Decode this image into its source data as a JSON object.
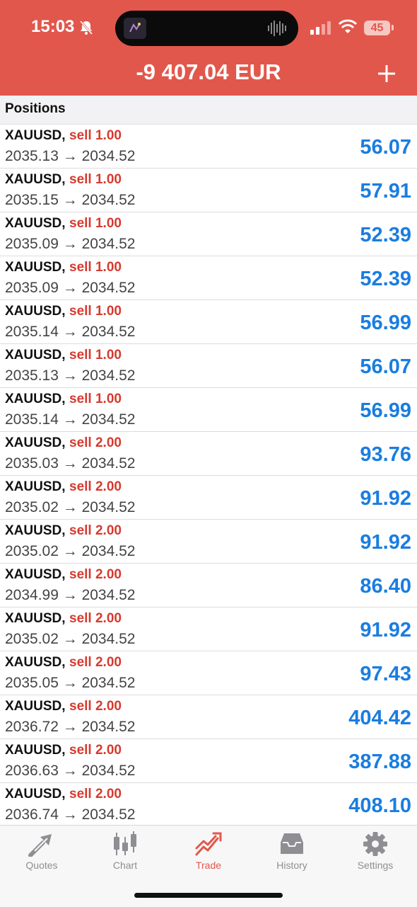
{
  "status_bar": {
    "time": "15:03",
    "battery": "45"
  },
  "header": {
    "balance": "-9 407.04 EUR"
  },
  "section": {
    "title": "Positions"
  },
  "positions": [
    {
      "symbol": "XAUUSD,",
      "side": "sell 1.00",
      "prices": "2035.13 → 2034.52",
      "profit": "56.07"
    },
    {
      "symbol": "XAUUSD,",
      "side": "sell 1.00",
      "prices": "2035.15 → 2034.52",
      "profit": "57.91"
    },
    {
      "symbol": "XAUUSD,",
      "side": "sell 1.00",
      "prices": "2035.09 → 2034.52",
      "profit": "52.39"
    },
    {
      "symbol": "XAUUSD,",
      "side": "sell 1.00",
      "prices": "2035.09 → 2034.52",
      "profit": "52.39"
    },
    {
      "symbol": "XAUUSD,",
      "side": "sell 1.00",
      "prices": "2035.14 → 2034.52",
      "profit": "56.99"
    },
    {
      "symbol": "XAUUSD,",
      "side": "sell 1.00",
      "prices": "2035.13 → 2034.52",
      "profit": "56.07"
    },
    {
      "symbol": "XAUUSD,",
      "side": "sell 1.00",
      "prices": "2035.14 → 2034.52",
      "profit": "56.99"
    },
    {
      "symbol": "XAUUSD,",
      "side": "sell 2.00",
      "prices": "2035.03 → 2034.52",
      "profit": "93.76"
    },
    {
      "symbol": "XAUUSD,",
      "side": "sell 2.00",
      "prices": "2035.02 → 2034.52",
      "profit": "91.92"
    },
    {
      "symbol": "XAUUSD,",
      "side": "sell 2.00",
      "prices": "2035.02 → 2034.52",
      "profit": "91.92"
    },
    {
      "symbol": "XAUUSD,",
      "side": "sell 2.00",
      "prices": "2034.99 → 2034.52",
      "profit": "86.40"
    },
    {
      "symbol": "XAUUSD,",
      "side": "sell 2.00",
      "prices": "2035.02 → 2034.52",
      "profit": "91.92"
    },
    {
      "symbol": "XAUUSD,",
      "side": "sell 2.00",
      "prices": "2035.05 → 2034.52",
      "profit": "97.43"
    },
    {
      "symbol": "XAUUSD,",
      "side": "sell 2.00",
      "prices": "2036.72 → 2034.52",
      "profit": "404.42"
    },
    {
      "symbol": "XAUUSD,",
      "side": "sell 2.00",
      "prices": "2036.63 → 2034.52",
      "profit": "387.88"
    },
    {
      "symbol": "XAUUSD,",
      "side": "sell 2.00",
      "prices": "2036.74 → 2034.52",
      "profit": "408.10"
    }
  ],
  "tabs": [
    {
      "label": "Quotes",
      "icon": "quotes-arrows-icon",
      "active": false
    },
    {
      "label": "Chart",
      "icon": "candlestick-icon",
      "active": false
    },
    {
      "label": "Trade",
      "icon": "trend-up-icon",
      "active": true
    },
    {
      "label": "History",
      "icon": "inbox-tray-icon",
      "active": false
    },
    {
      "label": "Settings",
      "icon": "gear-icon",
      "active": false
    }
  ],
  "colors": {
    "header_bg": "#e2574c",
    "sell": "#d63a2f",
    "profit": "#1a7de0",
    "tab_active": "#e2574c",
    "tab_inactive": "#8e8e93"
  }
}
